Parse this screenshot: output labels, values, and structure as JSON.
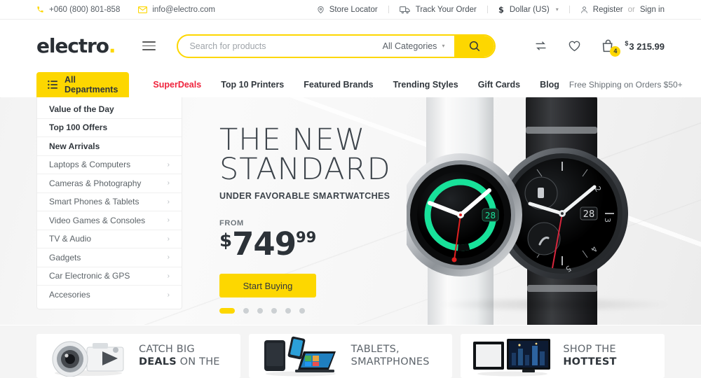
{
  "topbar": {
    "phone": "+060 (800) 801-858",
    "email": "info@electro.com",
    "store_locator": "Store Locator",
    "track_order": "Track Your Order",
    "currency": "Dollar (US)",
    "register": "Register",
    "or": "or",
    "signin": "Sign in"
  },
  "header": {
    "logo": "electro",
    "logo_dot": ".",
    "search_placeholder": "Search for products",
    "search_value": "",
    "categories": "All Categories",
    "cart_count": "4",
    "cart_currency": "$",
    "cart_total": "3 215.99"
  },
  "nav": {
    "departments": "All Departments",
    "links": [
      {
        "label": "SuperDeals",
        "highlight": true
      },
      {
        "label": "Top 10 Printers",
        "highlight": false
      },
      {
        "label": "Featured Brands",
        "highlight": false
      },
      {
        "label": "Trending Styles",
        "highlight": false
      },
      {
        "label": "Gift Cards",
        "highlight": false
      },
      {
        "label": "Blog",
        "highlight": false
      }
    ],
    "note": "Free Shipping on Orders $50+"
  },
  "sidemenu": {
    "items": [
      {
        "label": "Value of the Day",
        "bold": true,
        "arrow": false
      },
      {
        "label": "Top 100 Offers",
        "bold": true,
        "arrow": false
      },
      {
        "label": "New Arrivals",
        "bold": true,
        "arrow": false
      },
      {
        "label": "Laptops & Computers",
        "bold": false,
        "arrow": true
      },
      {
        "label": "Cameras & Photography",
        "bold": false,
        "arrow": true
      },
      {
        "label": "Smart Phones & Tablets",
        "bold": false,
        "arrow": true
      },
      {
        "label": "Video Games & Consoles",
        "bold": false,
        "arrow": true
      },
      {
        "label": "TV & Audio",
        "bold": false,
        "arrow": true
      },
      {
        "label": "Gadgets",
        "bold": false,
        "arrow": true
      },
      {
        "label": "Car Electronic & GPS",
        "bold": false,
        "arrow": true
      },
      {
        "label": "Accesories",
        "bold": false,
        "arrow": true
      }
    ]
  },
  "hero": {
    "title_line1": "THE NEW",
    "title_line2": "STANDARD",
    "subtitle": "UNDER FAVORABLE SMARTWATCHES",
    "from_label": "FROM",
    "price_currency": "$",
    "price_int": "749",
    "price_dec": "99",
    "cta": "Start Buying",
    "slide_count": 6,
    "active_slide": 1,
    "watch_left_date": "28",
    "watch_right_date": "28"
  },
  "promos": [
    {
      "line1": "CATCH BIG",
      "line2_bold": "DEALS",
      "line2_rest": " ON THE",
      "image": "camera-promo-image"
    },
    {
      "line1": "TABLETS,",
      "line2_bold": "",
      "line2_rest": "SMARTPHONES",
      "image": "tablets-promo-image"
    },
    {
      "line1": "SHOP THE",
      "line2_bold": "HOTTEST",
      "line2_rest": "",
      "image": "tv-promo-image"
    }
  ],
  "colors": {
    "accent_yellow": "#fdd700",
    "deal_red": "#ef233c",
    "text_dark": "#31373d",
    "watch_ring_green": "#18e29a"
  }
}
